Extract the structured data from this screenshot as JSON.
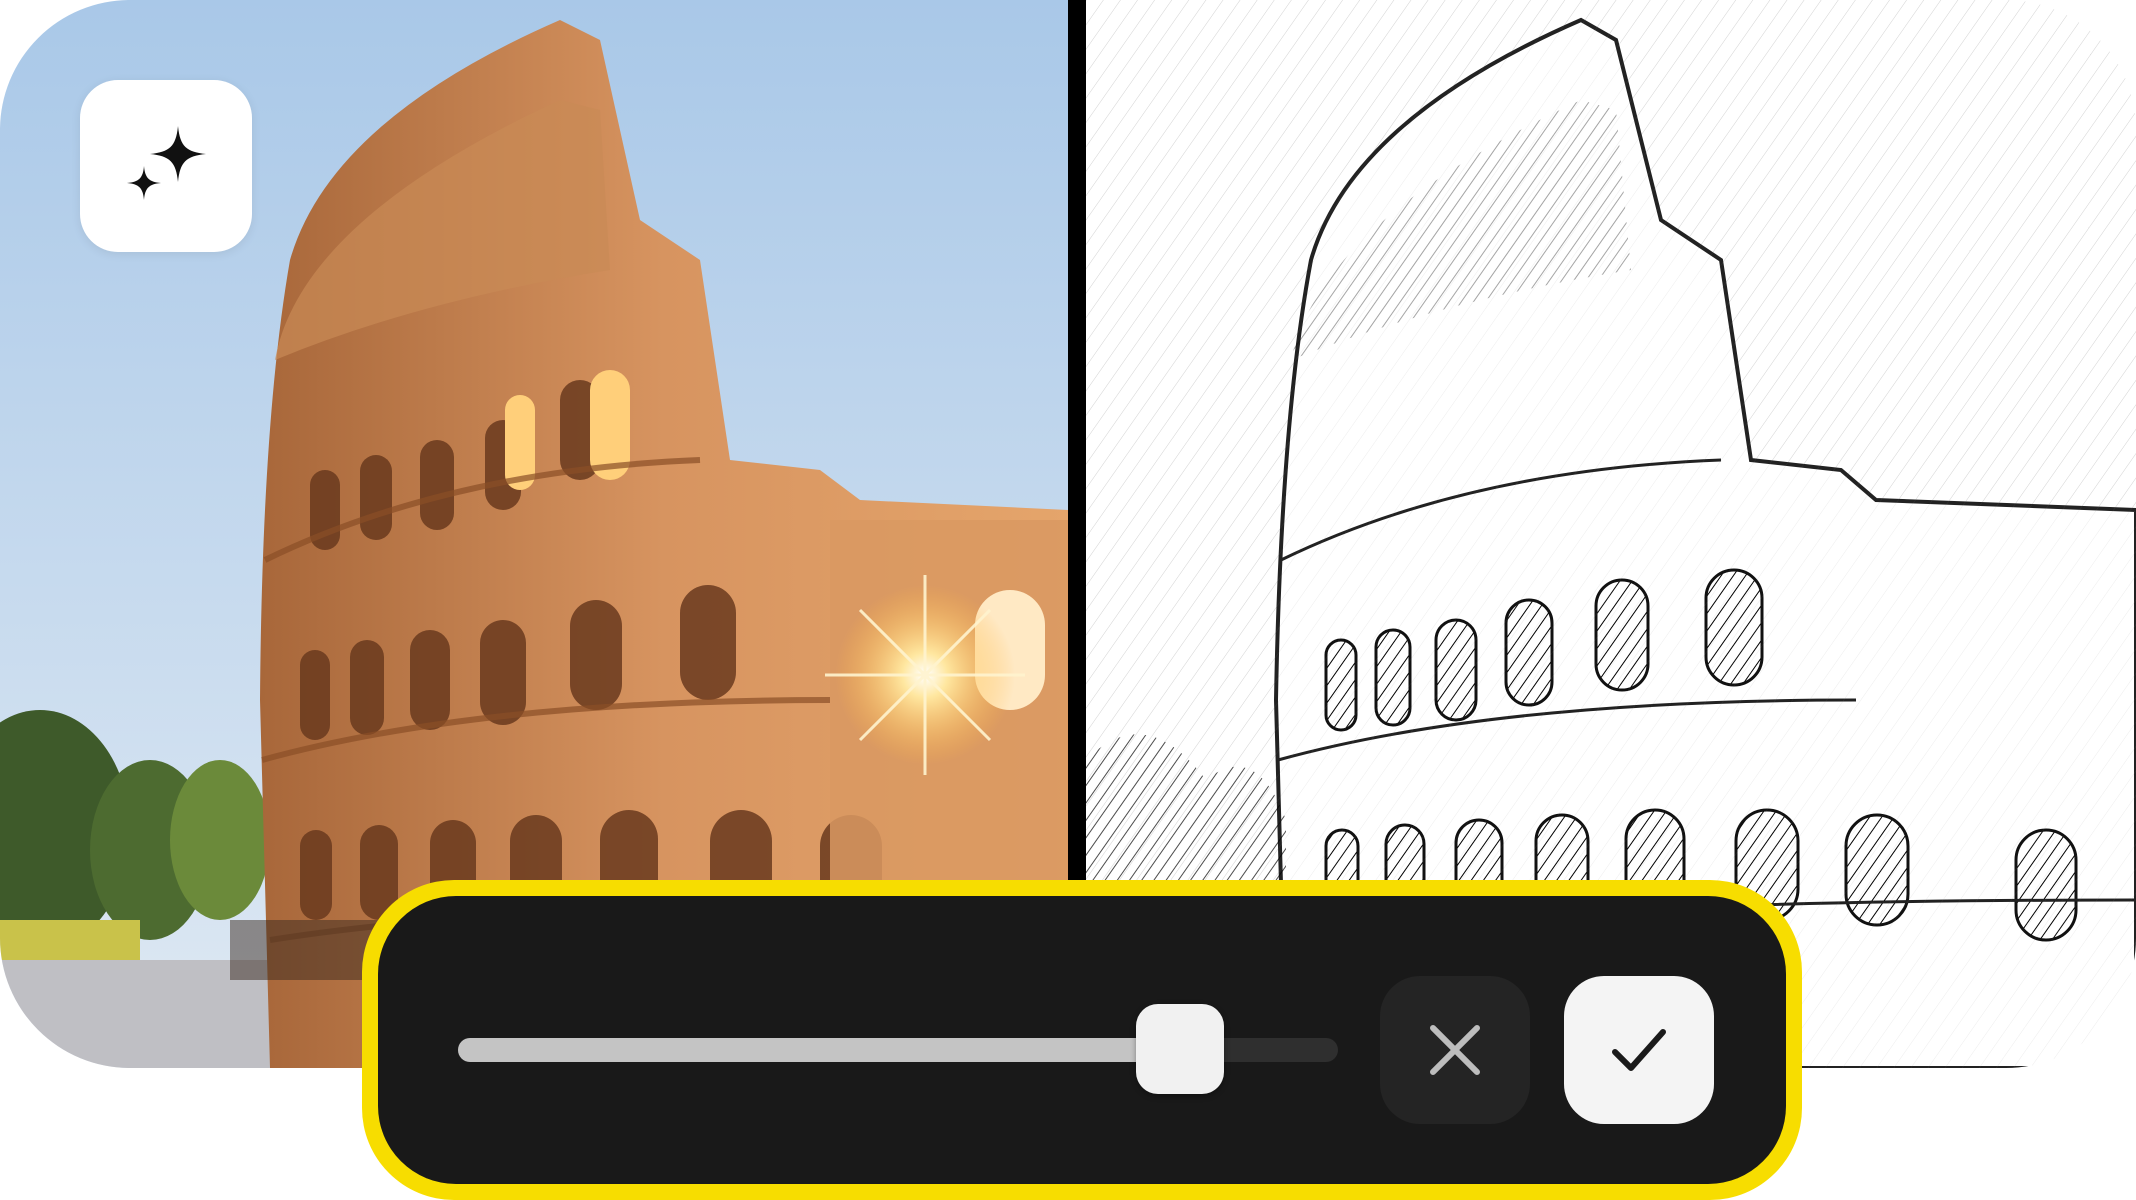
{
  "colors": {
    "accent_border": "#f7dd00",
    "control_background": "#191919",
    "slider_fill": "#c4c4c4",
    "slider_track": "#2f2f2f",
    "confirm_background": "#f4f4f4",
    "cancel_background": "#242424"
  },
  "badge": {
    "icon": "sparkles-icon"
  },
  "images": {
    "original": {
      "subject": "colosseum-photo"
    },
    "processed": {
      "subject": "colosseum-pencil-sketch"
    }
  },
  "controls": {
    "slider": {
      "value": 0.82,
      "min": 0,
      "max": 1
    },
    "cancel": {
      "icon": "close-icon"
    },
    "confirm": {
      "icon": "check-icon"
    }
  }
}
